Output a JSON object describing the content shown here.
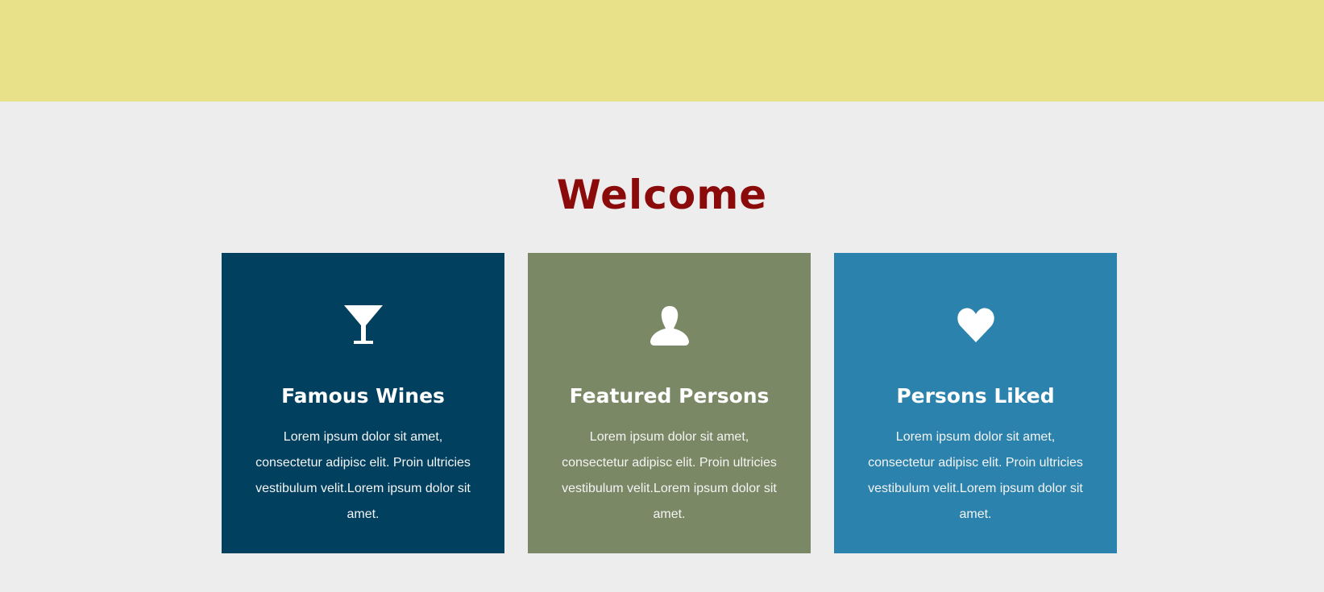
{
  "banner": {
    "color": "#e9e08a"
  },
  "welcome": {
    "title": "Welcome",
    "title_color": "#8b0a0a",
    "background": "#ededed"
  },
  "cards": [
    {
      "icon": "cocktail-glass-icon",
      "title": "Famous Wines",
      "text": "Lorem ipsum dolor sit amet, consectetur adipisc elit. Proin ultricies vestibulum velit.Lorem ipsum dolor sit amet.",
      "color": "#02405f"
    },
    {
      "icon": "user-icon",
      "title": "Featured Persons",
      "text": "Lorem ipsum dolor sit amet, consectetur adipisc elit. Proin ultricies vestibulum velit.Lorem ipsum dolor sit amet.",
      "color": "#7a8865"
    },
    {
      "icon": "heart-icon",
      "title": "Persons Liked",
      "text": "Lorem ipsum dolor sit amet, consectetur adipisc elit. Proin ultricies vestibulum velit.Lorem ipsum dolor sit amet.",
      "color": "#2b82ad"
    }
  ]
}
